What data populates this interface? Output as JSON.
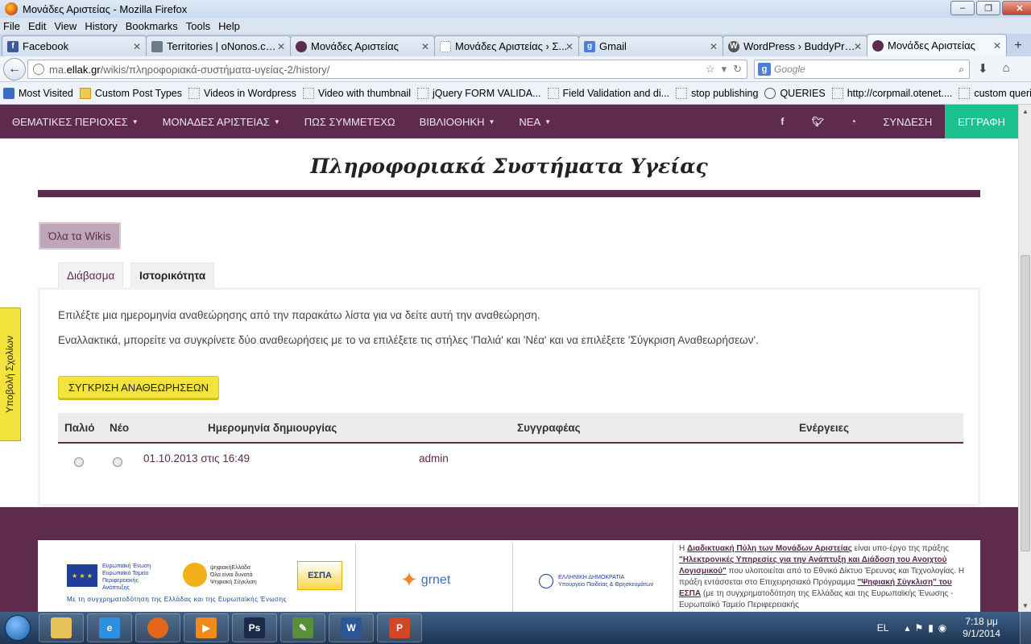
{
  "window": {
    "title": "Μονάδες Αριστείας - Mozilla Firefox",
    "controls": [
      "‒",
      "❐",
      "✕"
    ]
  },
  "menu": [
    "File",
    "Edit",
    "View",
    "History",
    "Bookmarks",
    "Tools",
    "Help"
  ],
  "tabs": [
    {
      "label": "Facebook",
      "icon_color": "#3b5998",
      "icon_letter": "f"
    },
    {
      "label": "Territories | oNonos.com",
      "icon_color": "#6b7b8c",
      "icon_letter": ""
    },
    {
      "label": "Μονάδες Αριστείας",
      "icon_color": "#5e2a4e",
      "icon_letter": ""
    },
    {
      "label": "Μονάδες Αριστείας › Σ...",
      "icon_color": "#ffffff",
      "icon_letter": ""
    },
    {
      "label": "Gmail",
      "icon_color": "#4a7fd8",
      "icon_letter": "g"
    },
    {
      "label": "WordPress › BuddyPres...",
      "icon_color": "#555555",
      "icon_letter": "W"
    },
    {
      "label": "Μονάδες Αριστείας",
      "icon_color": "#5e2a4e",
      "icon_letter": ""
    }
  ],
  "nav": {
    "url_prefix": "ma.",
    "url_domain": "ellak.gr",
    "url_path": "/wikis/πληροφοριακά-συστήματα-υγείας-2/history/",
    "search_placeholder": "Google"
  },
  "bookmarks": [
    {
      "label": "Most Visited",
      "type": "mv"
    },
    {
      "label": "Custom Post Types",
      "type": "folder"
    },
    {
      "label": "Videos in Wordpress",
      "type": "page"
    },
    {
      "label": "Video with thumbnail",
      "type": "page"
    },
    {
      "label": "jQuery FORM VALIDA...",
      "type": "page"
    },
    {
      "label": "Field Validation and di...",
      "type": "page"
    },
    {
      "label": "stop publishing",
      "type": "page"
    },
    {
      "label": "QUERIES",
      "type": "wp"
    },
    {
      "label": "http://corpmail.otenet....",
      "type": "page"
    },
    {
      "label": "custom queries",
      "type": "page"
    }
  ],
  "site": {
    "menu": [
      {
        "label": "ΘΕΜΑΤΙΚΕΣ ΠΕΡΙΟΧΕΣ",
        "caret": true
      },
      {
        "label": "ΜΟΝΑΔΕΣ ΑΡΙΣΤΕΙΑΣ",
        "caret": true
      },
      {
        "label": "ΠΩΣ ΣΥΜΜΕΤΕΧΩ",
        "caret": false
      },
      {
        "label": "ΒΙΒΛΙΟΘΗΚΗ",
        "caret": true
      },
      {
        "label": "ΝΕΑ",
        "caret": true
      }
    ],
    "social": [
      "f",
      "t",
      "rss"
    ],
    "login": "ΣΥΝΔΕΣΗ",
    "register": "ΕΓΓΡΑΦΗ",
    "title": "Πληροφοριακά Συστήματα Υγείας",
    "all_wikis": "Όλα τα Wikis",
    "tab_read": "Διάβασμα",
    "tab_history": "Ιστορικότητα",
    "intro1": "Επιλέξτε μια ημερομηνία αναθεώρησης από την παρακάτω λίστα για να δείτε αυτή την αναθεώρηση.",
    "intro2": "Εναλλακτικά, μπορείτε να συγκρίνετε δύο αναθεωρήσεις με το να επιλέξετε τις στήλες 'Παλιά' και 'Νέα' και να επιλέξετε 'Σύγκριση Αναθεωρήσεων'.",
    "compare_button": "ΣΥΓΚΡΙΣΗ ΑΝΑΘΕΩΡΗΣΕΩΝ",
    "table": {
      "headers": [
        "Παλιό",
        "Νέο",
        "Ημερομηνία δημιουργίας",
        "Συγγραφέας",
        "Ενέργειες"
      ],
      "rows": [
        {
          "date": "01.10.2013 στις 16:49",
          "author": "admin"
        }
      ]
    },
    "feedback_tab": "Υποβολή Σχολίων",
    "footer": {
      "eu_text": [
        "Ευρωπαϊκή Ένωση",
        "Ευρωπαϊκό Ταμείο",
        "Περιφερειακής",
        "Ανάπτυξης"
      ],
      "psif_text": [
        "ψηφιακήΕλλάδα",
        "Όλα είναι δυνατά",
        "Ψηφιακή Σύγκλιση"
      ],
      "espa": "ΕΣΠΑ",
      "caption": "Με τη συγχρηματοδότηση της Ελλάδας και της Ευρωπαϊκής Ένωσης",
      "grnet": "grnet",
      "ministry": [
        "ΕΛΛΗΝΙΚΗ ΔΗΜΟΚΡΑΤΙΑ",
        "Υπουργείο Παιδείας & Θρησκευμάτων"
      ],
      "text_a": "Η ",
      "text_link1": "Διαδικτυακή Πύλη των Μονάδων Αριστείας",
      "text_b": " είναι υπο-έργο της πράξης ",
      "text_link2": "\"Ηλεκτρονικές Υπηρεσίες για την Ανάπτυξη και Διάδοση του Ανοιχτού Λογισμικού\"",
      "text_c": " που υλοποιείται από το Εθνικό Δίκτυο Έρευνας και Τεχνολογίας. Η πράξη εντάσσεται στο Επιχειρησιακό Πρόγραμμα ",
      "text_link3": "\"Ψηφιακή Σύγκλιση\" του ΕΣΠΑ",
      "text_d": " (με τη συγχρηματοδότηση της Ελλάδας και της Ευρωπαϊκής Ένωσης - Ευρωπαϊκό Ταμείο Περιφερειακής"
    }
  },
  "taskbar": {
    "apps": [
      {
        "name": "explorer",
        "color": "#e8c25a",
        "label": ""
      },
      {
        "name": "ie",
        "color": "#2d8fe0",
        "label": "e"
      },
      {
        "name": "firefox",
        "color": "#e2661a",
        "label": ""
      },
      {
        "name": "media",
        "color": "#f08a1a",
        "label": "▶"
      },
      {
        "name": "photoshop",
        "color": "#1b2a49",
        "label": "Ps"
      },
      {
        "name": "notepad",
        "color": "#5a8f3a",
        "label": "✎"
      },
      {
        "name": "word",
        "color": "#2b5797",
        "label": "W"
      },
      {
        "name": "powerpoint",
        "color": "#d24726",
        "label": "P"
      }
    ],
    "lang": "EL",
    "time": "7:18 μμ",
    "date": "9/1/2014"
  }
}
